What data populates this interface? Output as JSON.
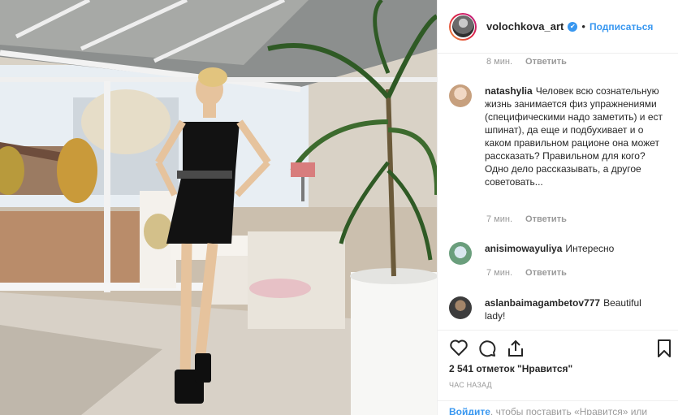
{
  "header": {
    "username": "volochkova_art",
    "verified_badge": "✔",
    "separator": "•",
    "follow_label": "Подписаться"
  },
  "comments": [
    {
      "user": "",
      "text": "",
      "time": "8 мин.",
      "reply_label": "Ответить"
    },
    {
      "user": "natashylia",
      "text": "Человек всю сознательную жизнь занимается физ упражнениями (специфическими надо заметить) и ест шпинат), да еще и подбухивает и о каком правильном рационе она может рассказать? Правильном для кого? Одно дело рассказывать, а другое советовать...",
      "time": "7 мин.",
      "reply_label": "Ответить"
    },
    {
      "user": "anisimowayuliya",
      "text": "Интересно",
      "time": "7 мин.",
      "reply_label": "Ответить"
    },
    {
      "user": "aslanbaimagambetov777",
      "text": "Beautiful lady!",
      "time": "",
      "reply_label": ""
    }
  ],
  "actions": {
    "likes_text": "2 541 отметок \"Нравится\"",
    "timestamp": "ЧАС НАЗАД",
    "login_link": "Войдите",
    "login_prompt": ", чтобы поставить «Нравится» или"
  },
  "colors": {
    "accent": "#3897f0",
    "muted": "#999999",
    "text": "#262626"
  }
}
